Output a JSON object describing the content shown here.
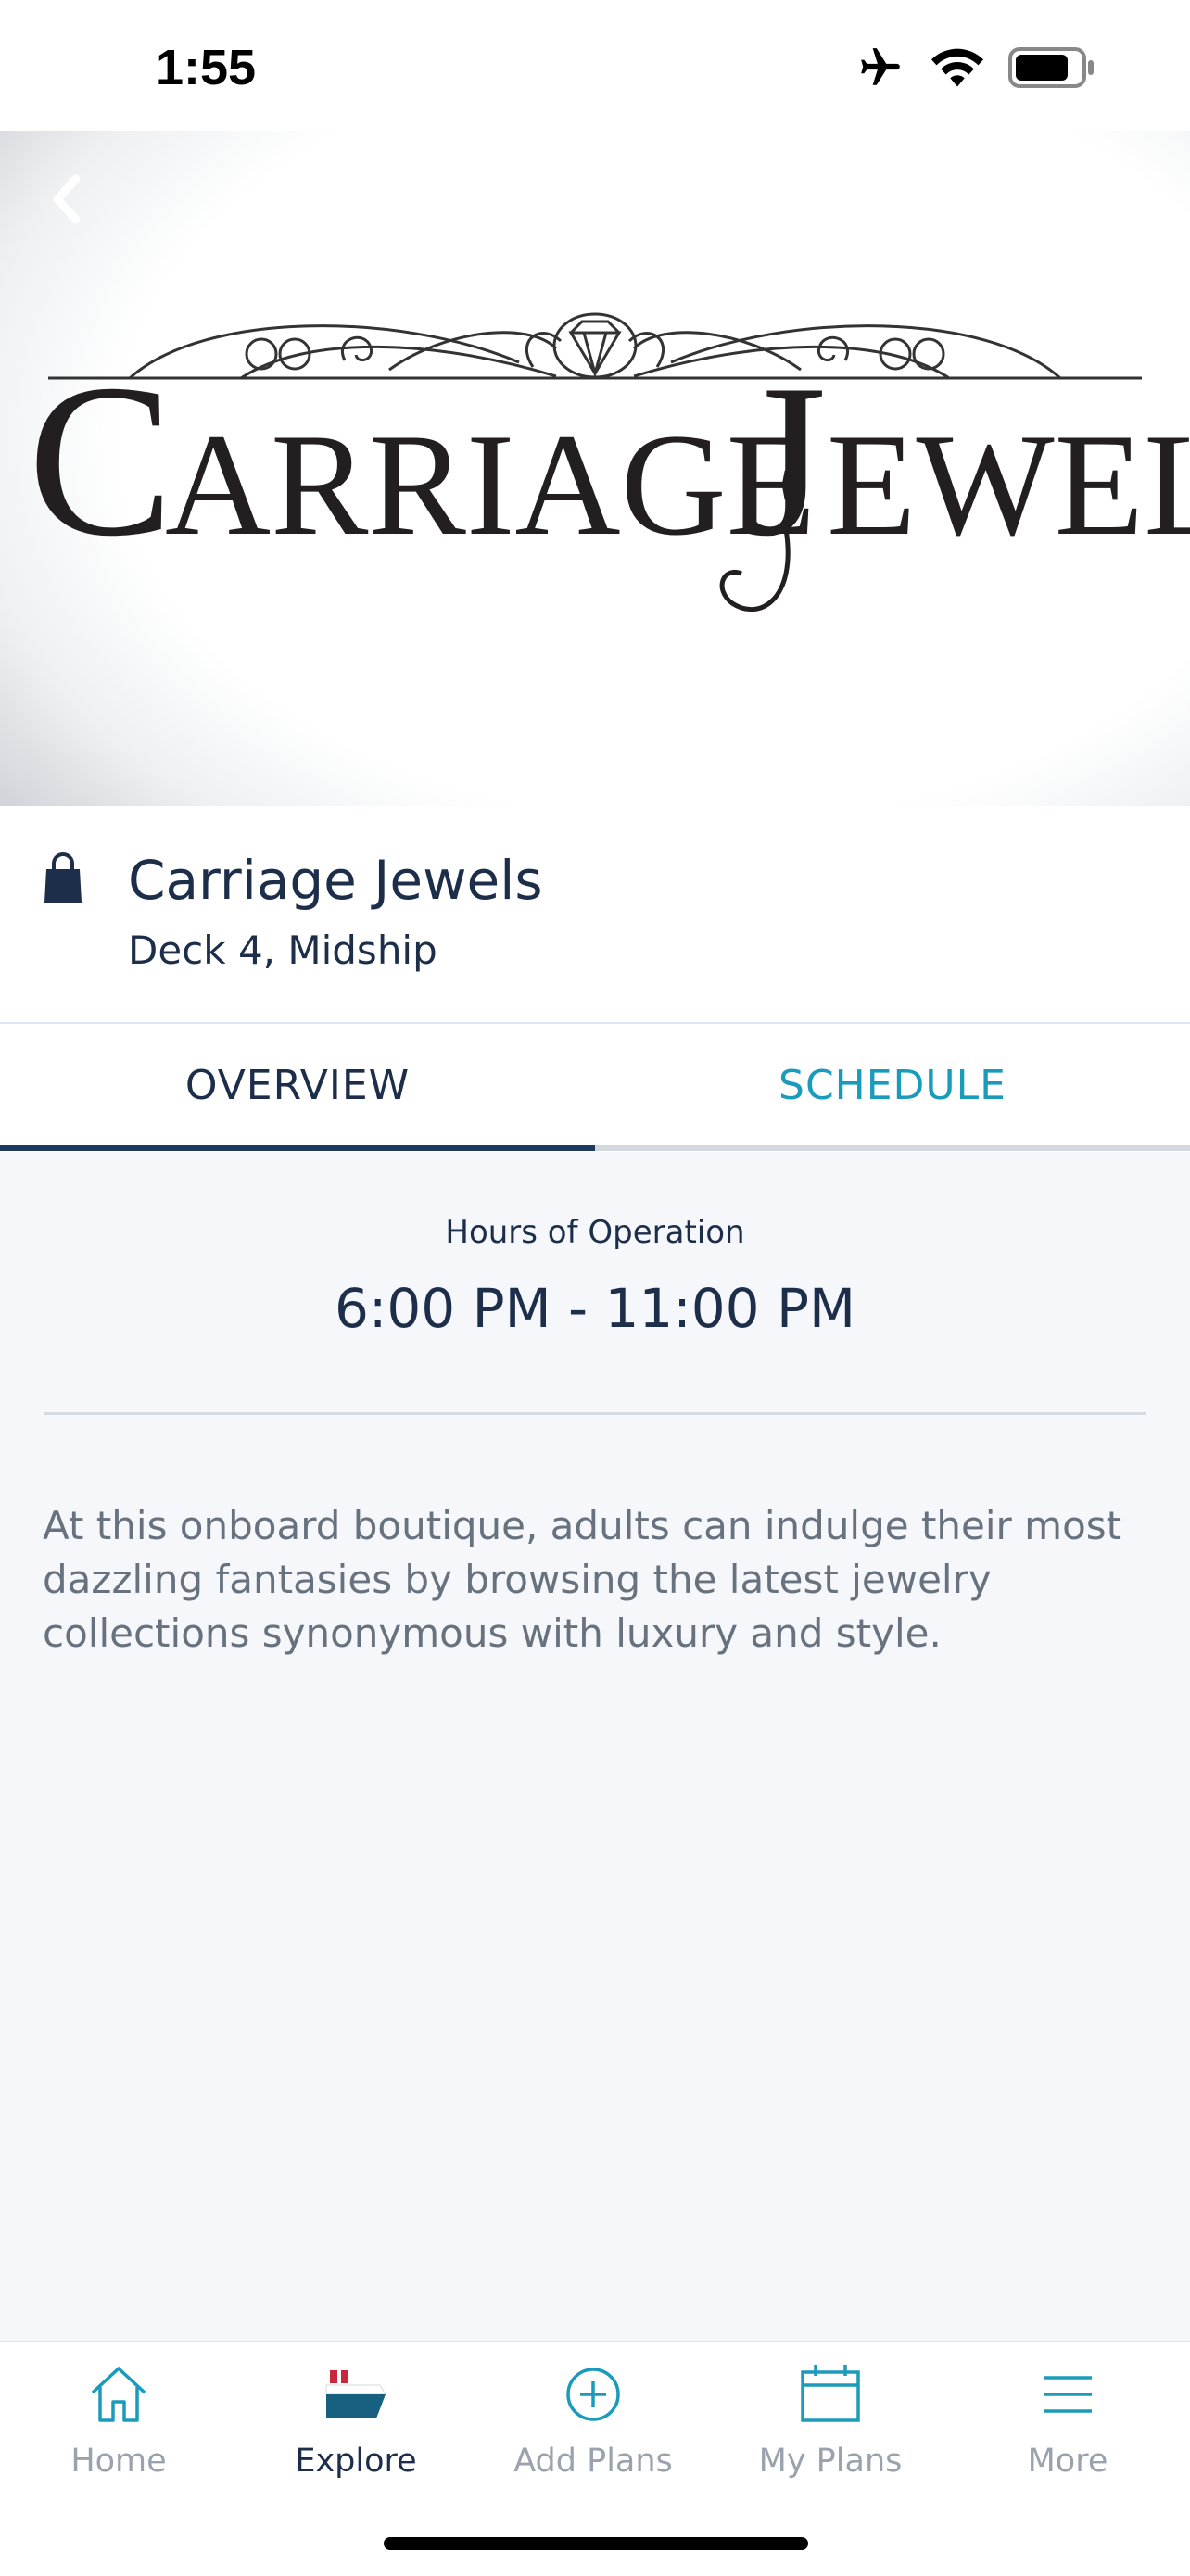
{
  "status_bar": {
    "time": "1:55",
    "icons": [
      "airplane-icon",
      "wifi-icon",
      "battery-icon"
    ]
  },
  "hero": {
    "logo_text": "CARRIAGE JEWELS",
    "back_icon": "chevron-left-icon"
  },
  "venue": {
    "icon": "shopping-bag-icon",
    "name": "Carriage Jewels",
    "location": "Deck 4, Midship"
  },
  "tabs": [
    {
      "label": "OVERVIEW",
      "active": true
    },
    {
      "label": "SCHEDULE",
      "active": false
    }
  ],
  "overview": {
    "hours_label": "Hours of Operation",
    "hours_value": "6:00 PM - 11:00 PM",
    "description": "At this onboard boutique, adults can indulge their most dazzling fantasies by browsing the latest jewelry collections synonymous with luxury and style."
  },
  "bottom_nav": [
    {
      "label": "Home",
      "icon": "home-icon",
      "active": false
    },
    {
      "label": "Explore",
      "icon": "ship-icon",
      "active": true
    },
    {
      "label": "Add Plans",
      "icon": "plus-circle-icon",
      "active": false
    },
    {
      "label": "My Plans",
      "icon": "calendar-icon",
      "active": false
    },
    {
      "label": "More",
      "icon": "menu-icon",
      "active": false
    }
  ],
  "colors": {
    "navy": "#1c2e4a",
    "accent_teal": "#1a9bbb",
    "muted_gray": "#9aa3ad",
    "background": "#f5f7fb"
  }
}
